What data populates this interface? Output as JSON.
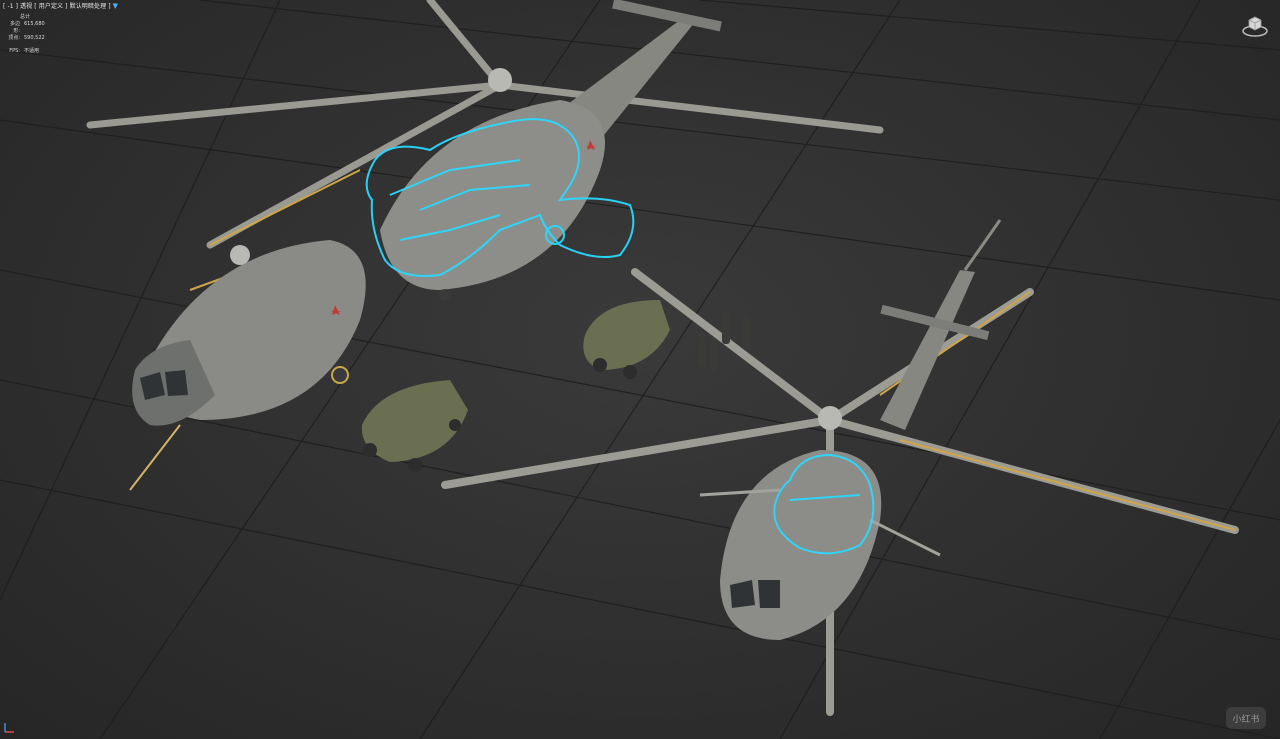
{
  "viewport": {
    "label": "[ -1 ] 透视 [ 用户定义 ] 默认明暗处理 ]",
    "filter_icon": "filter-icon"
  },
  "stats": {
    "header": "总计",
    "polys_label": "多边形:",
    "polys_value": "615,680",
    "verts_label": "顶点:",
    "verts_value": "590,522",
    "fps_label": "FPS:",
    "fps_value": "不适用"
  },
  "watermark": "小红书",
  "colors": {
    "selection": "#29d9ff",
    "grid": "#1f1f1f",
    "hull": "#8e8f8a",
    "vehicle": "#6b6f52"
  }
}
